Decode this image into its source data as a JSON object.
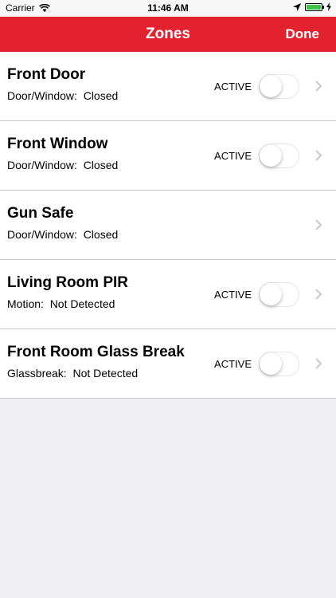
{
  "status_bar": {
    "carrier": "Carrier",
    "time": "11:46 AM"
  },
  "nav": {
    "title": "Zones",
    "done_label": "Done"
  },
  "zones": [
    {
      "name": "Front Door",
      "detail": "Door/Window:  Closed",
      "active_label": "ACTIVE",
      "active": false
    },
    {
      "name": "Front Window",
      "detail": "Door/Window:  Closed",
      "active_label": "ACTIVE",
      "active": false
    },
    {
      "name": "Gun Safe",
      "detail": "Door/Window:  Closed"
    },
    {
      "name": "Living Room PIR",
      "detail": "Motion:  Not Detected",
      "active_label": "ACTIVE",
      "active": false
    },
    {
      "name": "Front Room Glass Break",
      "detail": "Glassbreak:  Not Detected",
      "active_label": "ACTIVE",
      "active": false
    }
  ],
  "colors": {
    "nav_bg": "#e32230",
    "background": "#efeff4",
    "battery": "#3fc44a"
  }
}
